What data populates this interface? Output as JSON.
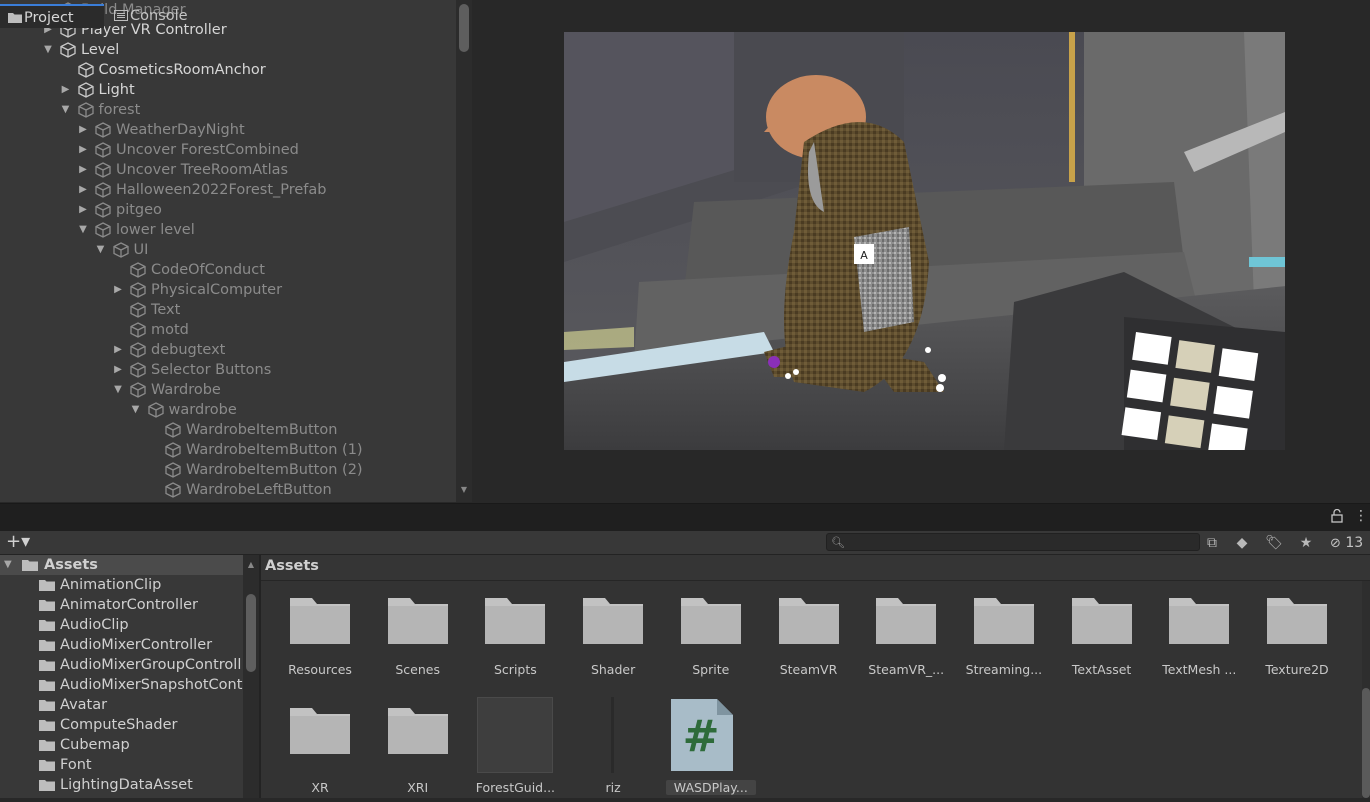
{
  "hierarchy": {
    "items": [
      {
        "label": "Build Manager",
        "state": "inactive",
        "arrow": ""
      },
      {
        "label": "Player VR Controller",
        "state": "active",
        "arrow": "right"
      },
      {
        "label": "Level",
        "state": "active",
        "arrow": "down"
      },
      {
        "label": "CosmeticsRoomAnchor",
        "state": "active",
        "arrow": ""
      },
      {
        "label": "Light",
        "state": "active",
        "arrow": "right"
      },
      {
        "label": "forest",
        "state": "inactive",
        "arrow": "down"
      },
      {
        "label": "WeatherDayNight",
        "state": "inactive",
        "arrow": "right"
      },
      {
        "label": "Uncover ForestCombined",
        "state": "inactive",
        "arrow": "right"
      },
      {
        "label": "Uncover TreeRoomAtlas",
        "state": "inactive",
        "arrow": "right"
      },
      {
        "label": "Halloween2022Forest_Prefab",
        "state": "inactive",
        "arrow": "right"
      },
      {
        "label": "pitgeo",
        "state": "inactive",
        "arrow": "right"
      },
      {
        "label": "lower level",
        "state": "inactive",
        "arrow": "down"
      },
      {
        "label": "UI",
        "state": "inactive",
        "arrow": "down"
      },
      {
        "label": "CodeOfConduct",
        "state": "inactive",
        "arrow": ""
      },
      {
        "label": "PhysicalComputer",
        "state": "inactive",
        "arrow": "right"
      },
      {
        "label": "Text",
        "state": "inactive",
        "arrow": ""
      },
      {
        "label": "motd",
        "state": "inactive",
        "arrow": ""
      },
      {
        "label": "debugtext",
        "state": "inactive",
        "arrow": "right"
      },
      {
        "label": "Selector Buttons",
        "state": "inactive",
        "arrow": "right"
      },
      {
        "label": "Wardrobe",
        "state": "inactive",
        "arrow": "down"
      },
      {
        "label": "wardrobe",
        "state": "inactive",
        "arrow": "down"
      },
      {
        "label": "WardrobeItemButton",
        "state": "inactive",
        "arrow": ""
      },
      {
        "label": "WardrobeItemButton (1)",
        "state": "inactive",
        "arrow": ""
      },
      {
        "label": "WardrobeItemButton (2)",
        "state": "inactive",
        "arrow": ""
      },
      {
        "label": "WardrobeLeftButton",
        "state": "inactive",
        "arrow": ""
      }
    ]
  },
  "scene": {
    "badge_text": "A"
  },
  "tabs": {
    "project": "Project",
    "console": "Console"
  },
  "toolbar": {
    "add_label": "+▾",
    "search_placeholder": "",
    "hidden_count": "13"
  },
  "tree": {
    "root": "Assets",
    "items": [
      "AnimationClip",
      "AnimatorController",
      "AudioClip",
      "AudioMixerController",
      "AudioMixerGroupControll",
      "AudioMixerSnapshotCont",
      "Avatar",
      "ComputeShader",
      "Cubemap",
      "Font",
      "LightingDataAsset"
    ]
  },
  "assets": {
    "title": "Assets",
    "tiles": [
      {
        "label": "Resources",
        "kind": "folder"
      },
      {
        "label": "Scenes",
        "kind": "folder"
      },
      {
        "label": "Scripts",
        "kind": "folder"
      },
      {
        "label": "Shader",
        "kind": "folder"
      },
      {
        "label": "Sprite",
        "kind": "folder"
      },
      {
        "label": "SteamVR",
        "kind": "folder"
      },
      {
        "label": "SteamVR_...",
        "kind": "folder"
      },
      {
        "label": "Streaming...",
        "kind": "folder"
      },
      {
        "label": "TextAsset",
        "kind": "folder"
      },
      {
        "label": "TextMesh ...",
        "kind": "folder"
      },
      {
        "label": "Texture2D",
        "kind": "folder"
      },
      {
        "label": "XR",
        "kind": "folder"
      },
      {
        "label": "XRI",
        "kind": "folder"
      },
      {
        "label": "ForestGuid...",
        "kind": "texture"
      },
      {
        "label": "riz",
        "kind": "thin"
      },
      {
        "label": "WASDPlay...",
        "kind": "script"
      }
    ]
  },
  "colors": {
    "panel": "#383838",
    "accent": "#3a7dd8",
    "script_green": "#2e6b3a"
  }
}
